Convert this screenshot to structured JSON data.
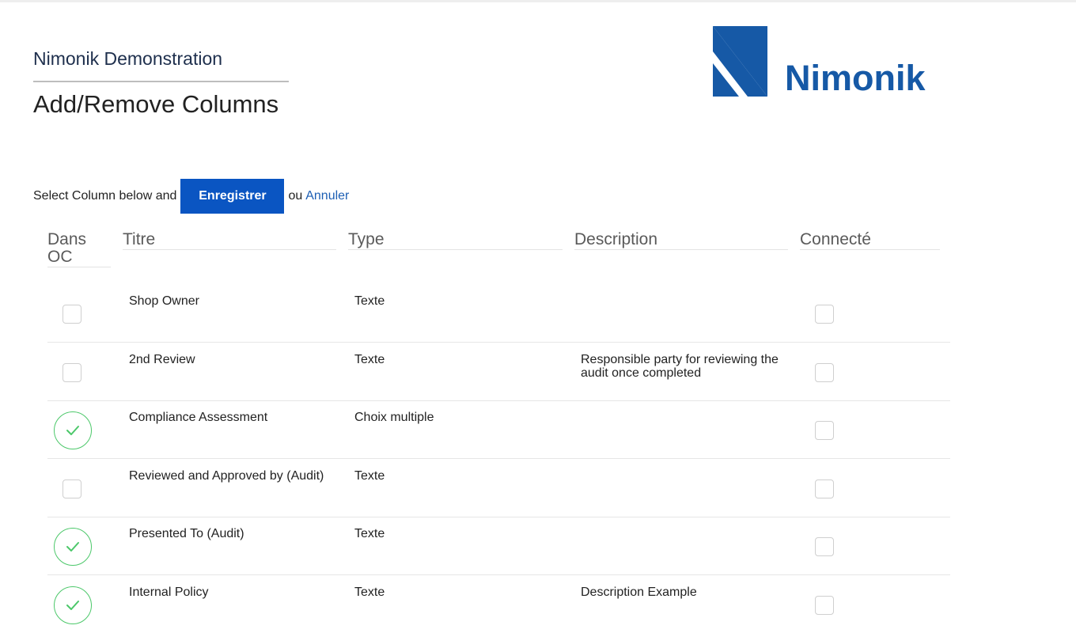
{
  "header": {
    "org_name": "Nimonik Demonstration",
    "page_title": "Add/Remove Columns",
    "logo_text": "Nimonik",
    "brand_color": "#1659a6"
  },
  "actions": {
    "prompt": "Select Column below and",
    "save_label": "Enregistrer",
    "or_text": "ou",
    "cancel_label": "Annuler",
    "accent_color": "#0a55c2"
  },
  "columns": {
    "in_oc": "Dans OC",
    "title": "Titre",
    "type": "Type",
    "description": "Description",
    "connected": "Connecté"
  },
  "rows": [
    {
      "title": "Shop Owner",
      "type": "Texte",
      "description": "",
      "in_oc": false,
      "connected": false
    },
    {
      "title": "2nd Review",
      "type": "Texte",
      "description": "Responsible party for reviewing the audit once completed",
      "in_oc": false,
      "connected": false
    },
    {
      "title": "Compliance Assessment",
      "type": "Choix multiple",
      "description": "",
      "in_oc": true,
      "connected": false
    },
    {
      "title": "Reviewed and Approved by (Audit)",
      "type": "Texte",
      "description": "",
      "in_oc": false,
      "connected": false
    },
    {
      "title": "Presented To (Audit)",
      "type": "Texte",
      "description": "",
      "in_oc": true,
      "connected": false
    },
    {
      "title": "Internal Policy",
      "type": "Texte",
      "description": "Description Example",
      "in_oc": true,
      "connected": false
    }
  ]
}
